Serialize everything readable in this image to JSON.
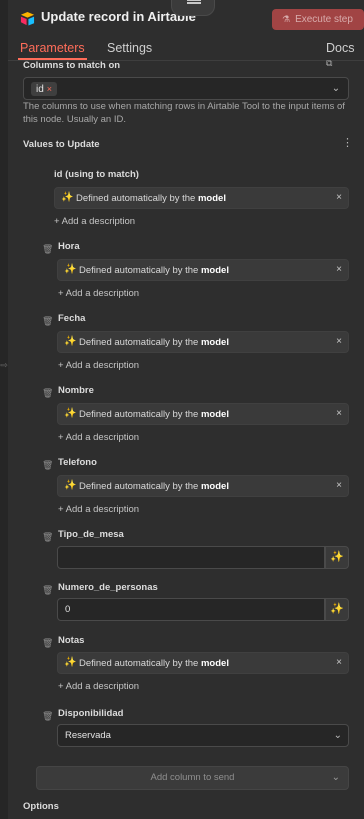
{
  "header": {
    "title": "Update record in Airtable",
    "execute_label": "Execute step"
  },
  "tabs": {
    "parameters": "Parameters",
    "settings": "Settings",
    "docs": "Docs"
  },
  "columns_to_match": {
    "label": "Columns to match on",
    "selected": "id",
    "hint": "The columns to use when matching rows in Airtable Tool to the input items of this node. Usually an ID."
  },
  "values_to_update": {
    "label": "Values to Update",
    "auto_prefix": "Defined automatically by the",
    "auto_bold": "model",
    "add_description": "+ Add a description",
    "fields": [
      {
        "name": "id (using to match)"
      },
      {
        "name": "Hora"
      },
      {
        "name": "Fecha"
      },
      {
        "name": "Nombre"
      },
      {
        "name": "Telefono"
      },
      {
        "name": "Tipo_de_mesa",
        "value": ""
      },
      {
        "name": "Numero_de_personas",
        "value": "0"
      },
      {
        "name": "Notas"
      },
      {
        "name": "Disponibilidad",
        "value": "Reservada"
      }
    ],
    "add_column_placeholder": "Add column to send"
  },
  "options": {
    "label": "Options"
  }
}
